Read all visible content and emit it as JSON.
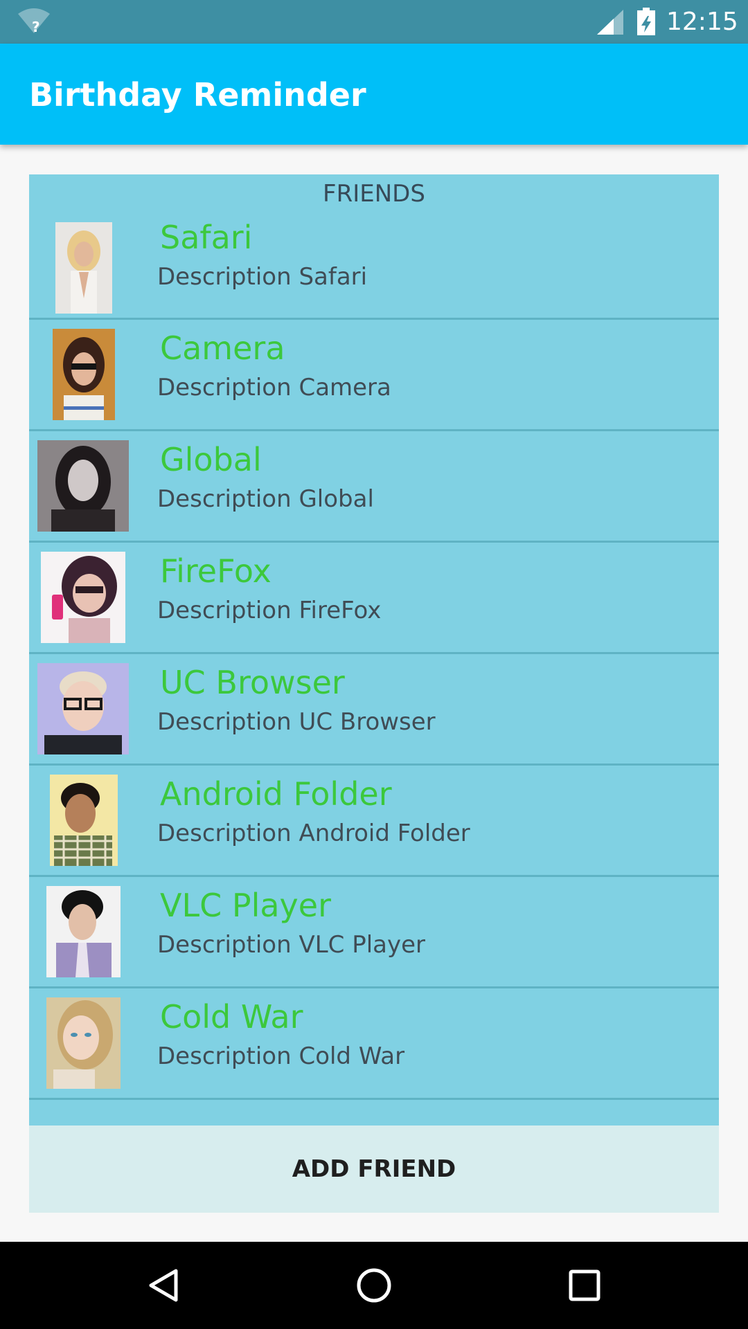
{
  "status_bar": {
    "time": "12:15",
    "wifi_icon": "wifi-unknown-icon",
    "signal_icon": "cell-signal-icon",
    "battery_icon": "battery-charging-icon",
    "color": "#3e8fa3"
  },
  "app_bar": {
    "title": "Birthday Reminder",
    "color": "#00bff8"
  },
  "friends": {
    "header": "FRIENDS",
    "panel_color": "#80d1e3",
    "name_color": "#3cc83c",
    "items": [
      {
        "name": "Safari",
        "description": "Description Safari"
      },
      {
        "name": "Camera",
        "description": "Description Camera"
      },
      {
        "name": "Global",
        "description": "Description Global"
      },
      {
        "name": "FireFox",
        "description": "Description FireFox"
      },
      {
        "name": "UC Browser",
        "description": "Description UC Browser"
      },
      {
        "name": "Android Folder",
        "description": "Description Android Folder"
      },
      {
        "name": "VLC Player",
        "description": "Description VLC Player"
      },
      {
        "name": "Cold War",
        "description": "Description Cold War"
      }
    ]
  },
  "add_friend_button": {
    "label": "ADD FRIEND"
  },
  "nav_bar": {
    "back_icon": "back-triangle-icon",
    "home_icon": "home-circle-icon",
    "recents_icon": "recents-square-icon"
  }
}
